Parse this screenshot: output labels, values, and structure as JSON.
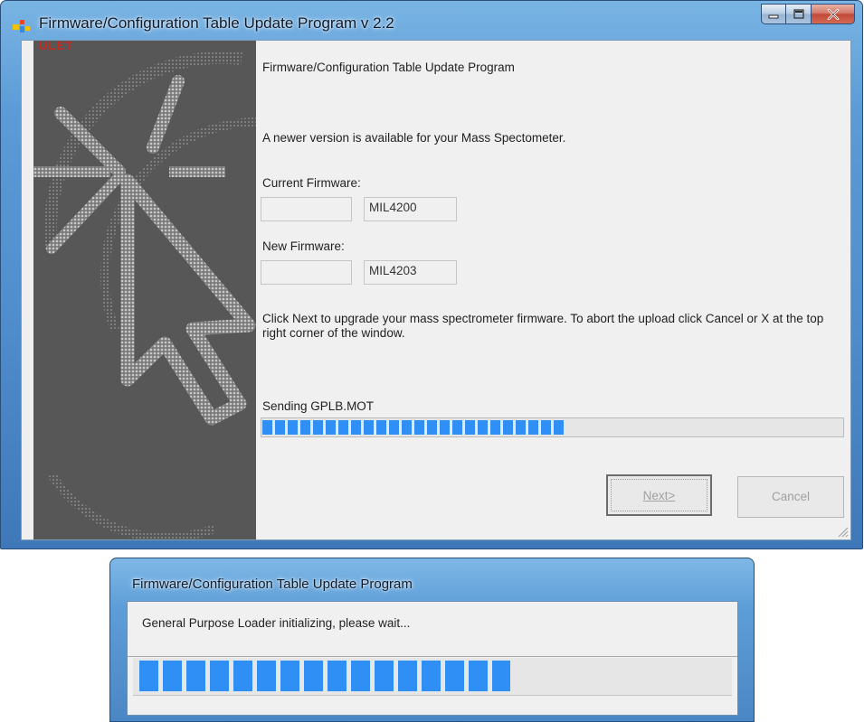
{
  "window": {
    "title": "Firmware/Configuration Table Update Program v 2.2",
    "buttons": {
      "minimize": "minimize",
      "maximize": "maximize",
      "close": "close"
    }
  },
  "branding": {
    "logo_text": "ULET"
  },
  "content": {
    "heading": "Firmware/Configuration Table Update Program",
    "message": "A newer version is available for your Mass Spectometer.",
    "current_firmware_label": "Current  Firmware:",
    "current_firmware_value": "MIL4200",
    "new_firmware_label": "New Firmware:",
    "new_firmware_value": "MIL4203",
    "instructions": "Click Next to upgrade your mass spectrometer firmware. To abort the upload click Cancel or X at the top right corner of the window.",
    "progress_label": "Sending GPLB.MOT",
    "progress_fraction": 0.52
  },
  "buttons": {
    "next": "Next>",
    "cancel": "Cancel"
  },
  "dialog": {
    "title": "Firmware/Configuration Table Update Program",
    "message": "General Purpose Loader initializing, please wait...",
    "progress_fraction": 0.62
  },
  "colors": {
    "progress": "#2f8ff5",
    "title_bar": "#5c9bd6",
    "side_panel": "#575757",
    "logo_red": "#c52a1e"
  },
  "icons": {
    "app": "app-icon",
    "minimize": "minimize-icon",
    "maximize": "maximize-icon",
    "close": "close-icon",
    "grip": "resize-grip-icon"
  }
}
